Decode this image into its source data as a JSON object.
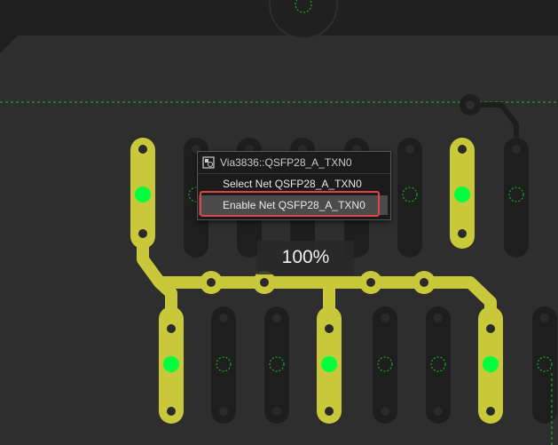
{
  "context_menu": {
    "header": "Via3836::QSFP28_A_TXN0",
    "header_icon": "via-icon",
    "items": [
      {
        "label": "Select Net QSFP28_A_TXN0",
        "highlighted": false
      },
      {
        "label": "Enable Net QSFP28_A_TXN0",
        "highlighted": true
      }
    ]
  },
  "zoom_level": "100%",
  "colors": {
    "background": "#2e2e2e",
    "shape_fill": "#202020",
    "net_highlight": "#c8c83a",
    "via_pad_green": "#00ff3c",
    "dashed_outline": "#19c42c",
    "callout_red": "#e04545"
  }
}
